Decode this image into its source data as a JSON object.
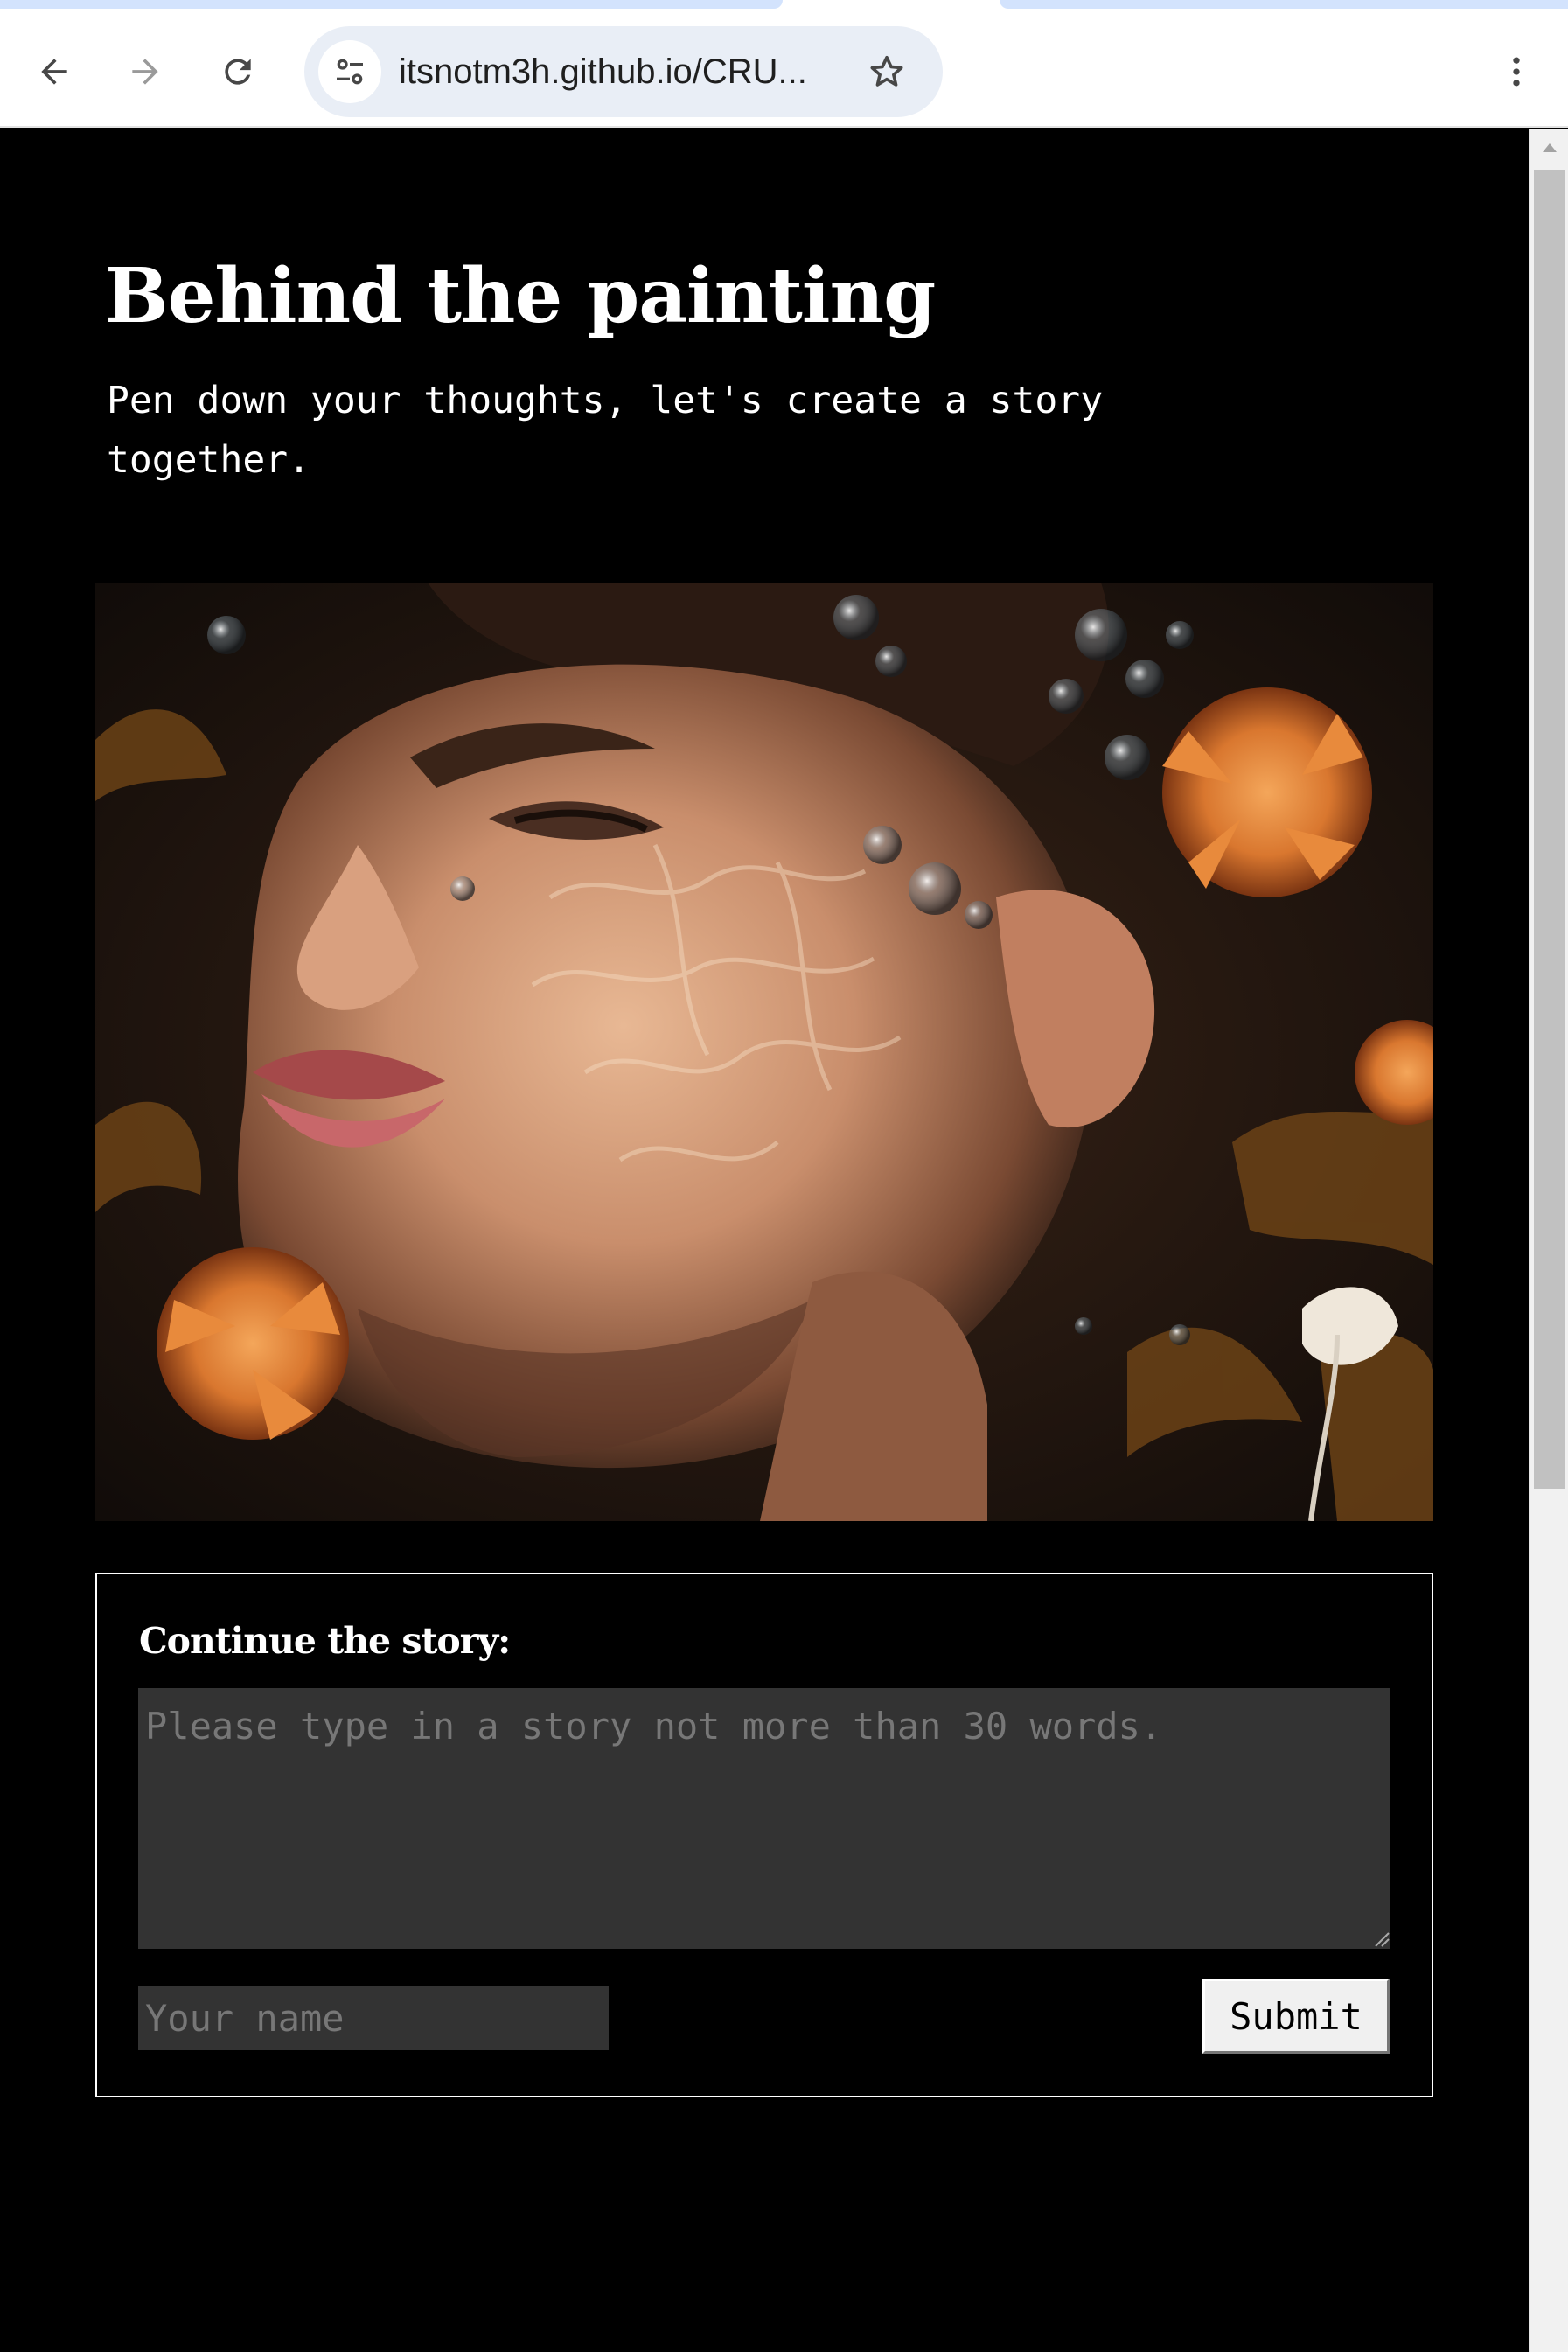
{
  "browser": {
    "url": "itsnotm3h.github.io/CRU...",
    "icons": {
      "back": "arrow-left-icon",
      "forward": "arrow-right-icon",
      "reload": "reload-icon",
      "site_info": "tune-icon",
      "bookmark": "star-outline-icon",
      "menu": "vertical-dots-icon"
    }
  },
  "page": {
    "title": "Behind the painting",
    "subtitle": "Pen down your thoughts, let's create a story together.",
    "painting": {
      "kind": "artwork-image"
    },
    "form": {
      "label": "Continue the story:",
      "story_placeholder": "Please type in a story not more than 30 words.",
      "story_value": "",
      "name_placeholder": "Your name",
      "name_value": "",
      "submit_label": "Submit"
    }
  },
  "colors": {
    "page_background": "#000000",
    "input_background": "#333333",
    "text": "#ffffff",
    "placeholder": "#777777",
    "accent_orange": "#d9772f"
  }
}
